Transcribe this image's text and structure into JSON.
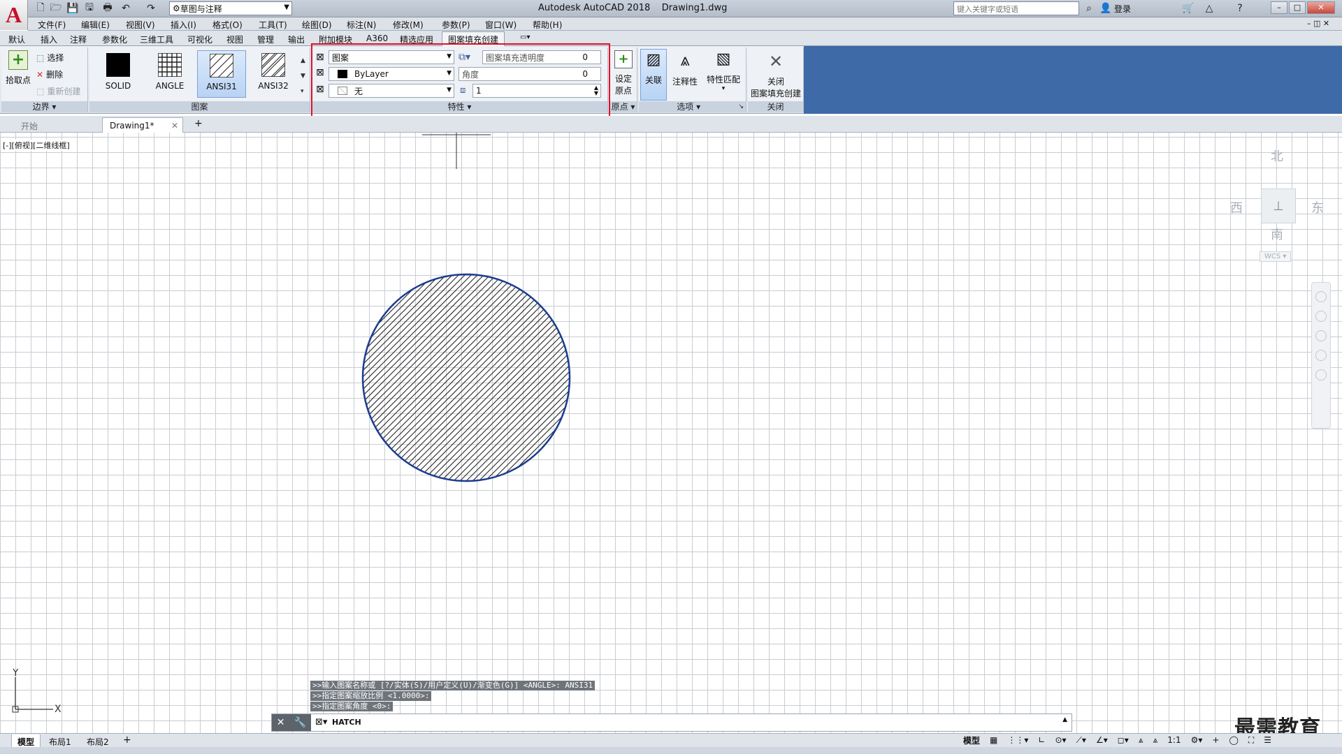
{
  "titlebar": {
    "app_logo": "A",
    "workspace": "草图与注释",
    "title": "Autodesk AutoCAD 2018",
    "filename": "Drawing1.dwg",
    "search_placeholder": "键入关键字或短语",
    "login": "登录"
  },
  "menu": [
    "文件(F)",
    "编辑(E)",
    "视图(V)",
    "插入(I)",
    "格式(O)",
    "工具(T)",
    "绘图(D)",
    "标注(N)",
    "修改(M)",
    "参数(P)",
    "窗口(W)",
    "帮助(H)"
  ],
  "ribbon_tabs": [
    "默认",
    "插入",
    "注释",
    "参数化",
    "三维工具",
    "可视化",
    "视图",
    "管理",
    "输出",
    "附加模块",
    "A360",
    "精选应用",
    "图案填充创建"
  ],
  "ribbon": {
    "boundary": {
      "pick_point": "拾取点",
      "select": "选择",
      "remove": "删除",
      "recreate": "重新创建",
      "title": "边界"
    },
    "pattern": {
      "tiles": [
        "SOLID",
        "ANGLE",
        "ANSI31",
        "ANSI32"
      ],
      "active": "ANSI31",
      "title": "图案"
    },
    "properties": {
      "type": "图案",
      "color": "ByLayer",
      "background": "无",
      "transparency_label": "图案填充透明度",
      "transparency_value": "0",
      "angle_label": "角度",
      "angle_value": "0",
      "scale_value": "1",
      "title": "特性"
    },
    "origin": {
      "set_origin_line1": "设定",
      "set_origin_line2": "原点",
      "title": "原点"
    },
    "options": {
      "associative": "关联",
      "annotative": "注释性",
      "match": "特性匹配",
      "title": "选项"
    },
    "close": {
      "line1": "关闭",
      "line2": "图案填充创建",
      "title": "关闭"
    }
  },
  "file_tabs": [
    "开始",
    "Drawing1*"
  ],
  "canvas": {
    "viewport_label": "[-][俯视][二维线框]",
    "compass": {
      "north": "北",
      "south": "南",
      "east": "东",
      "west": "西"
    },
    "wcs": "WCS",
    "ucs_y": "Y",
    "ucs_x": "X",
    "hatch": {
      "pattern": "ANSI31",
      "edge_color": "#1a3d8f"
    }
  },
  "command": {
    "history": [
      ">>输入图案名称或 [?/实体(S)/用户定义(U)/渐变色(G)] <ANGLE>: ANSI31",
      ">>指定图案缩放比例 <1.0000>:",
      ">>指定图案角度 <0>:"
    ],
    "current": "HATCH"
  },
  "layout_tabs": [
    "模型",
    "布局1",
    "布局2"
  ],
  "status": {
    "model": "模型",
    "scale": "1:1"
  },
  "watermark": "最需教育",
  "colors": {
    "accent": "#3e6aa7",
    "highlight": "#e0102a"
  }
}
